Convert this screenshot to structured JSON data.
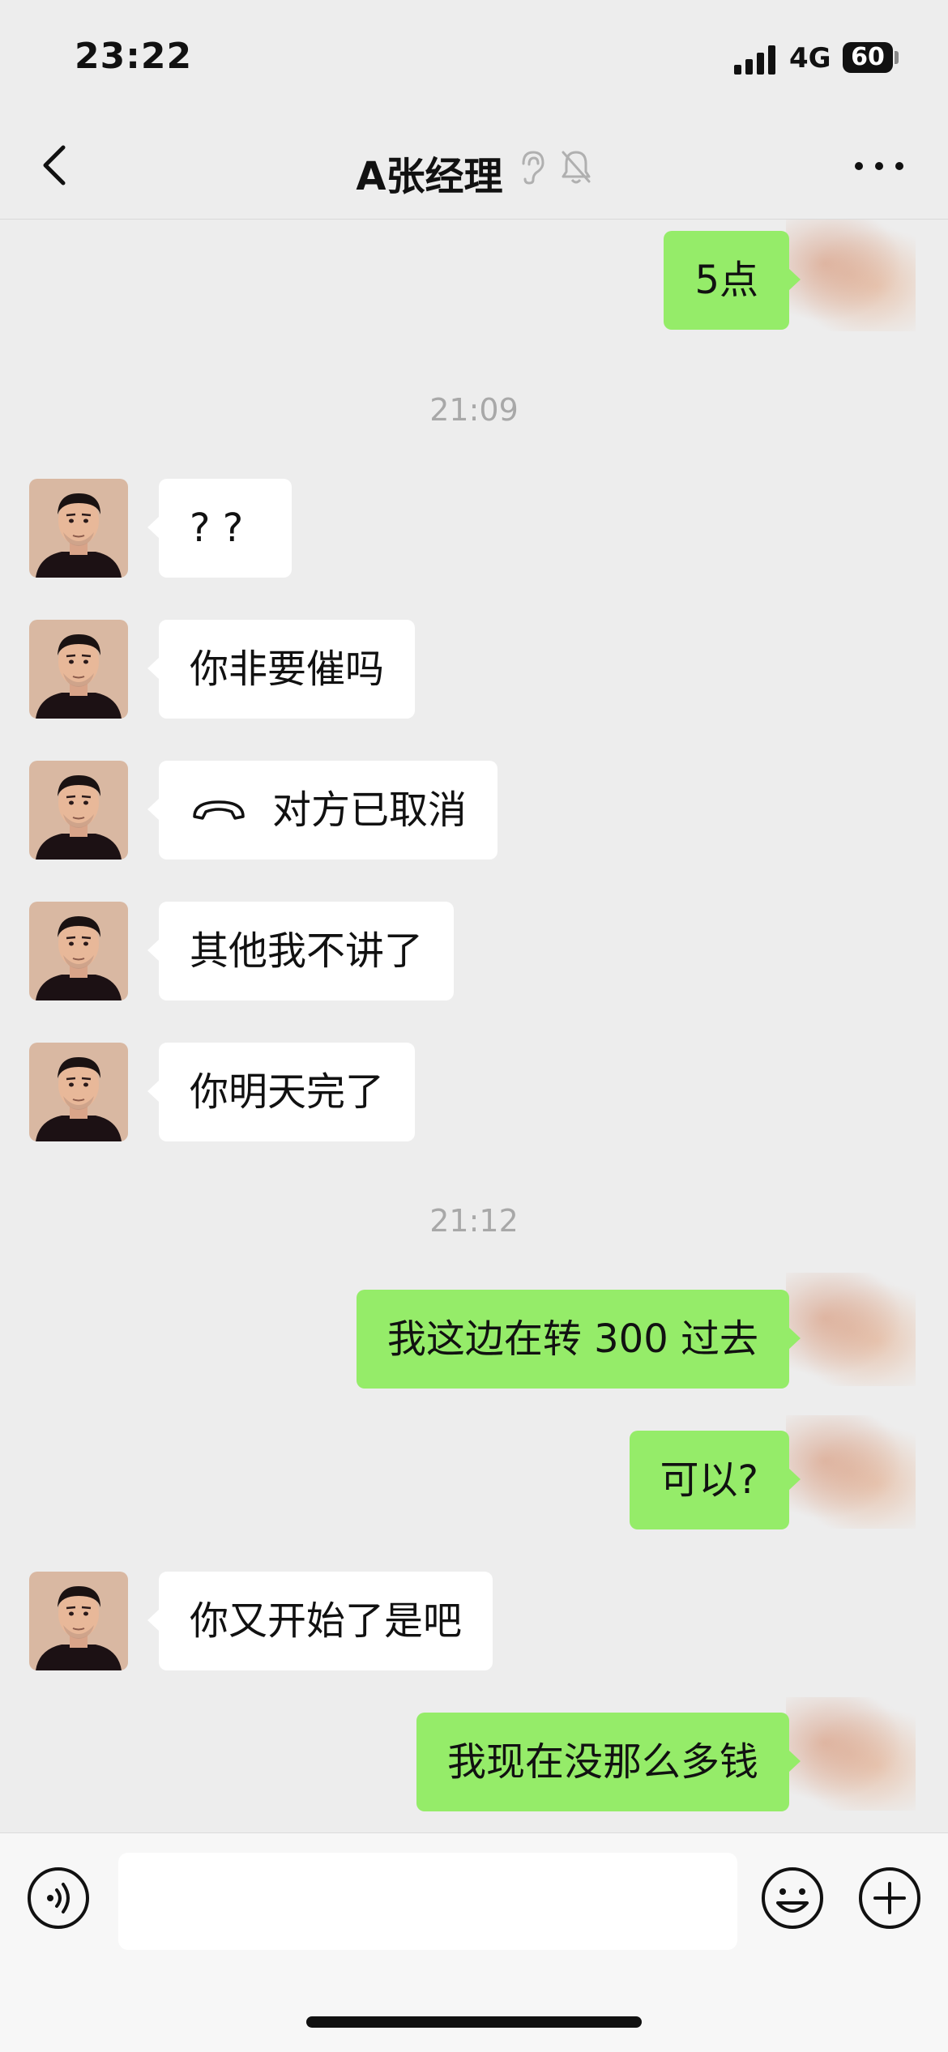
{
  "status_bar": {
    "time": "23:22",
    "network": "4G",
    "battery": "60"
  },
  "nav": {
    "title": "A张经理",
    "icons": [
      "back-icon",
      "ear-icon",
      "muted-bell-icon",
      "more-icon"
    ]
  },
  "messages": [
    {
      "side": "out",
      "text": "5点"
    },
    {
      "type": "time",
      "text": "21:09"
    },
    {
      "side": "in",
      "text": "? ?"
    },
    {
      "side": "in",
      "text": "你非要催吗"
    },
    {
      "side": "in",
      "text": "对方已取消",
      "icon": "call-icon"
    },
    {
      "side": "in",
      "text": "其他我不讲了"
    },
    {
      "side": "in",
      "text": "你明天完了"
    },
    {
      "type": "time",
      "text": "21:12"
    },
    {
      "side": "out",
      "text": "我这边在转 300 过去"
    },
    {
      "side": "out",
      "text": "可以?"
    },
    {
      "side": "in",
      "text": "你又开始了是吧"
    },
    {
      "side": "out",
      "text": "我现在没那么多钱"
    }
  ],
  "input_bar": {
    "icons": [
      "voice-icon",
      "emoji-icon",
      "plus-icon"
    ]
  },
  "colors": {
    "background": "#ededed",
    "outgoing_bubble": "#95ec69",
    "incoming_bubble": "#ffffff"
  }
}
